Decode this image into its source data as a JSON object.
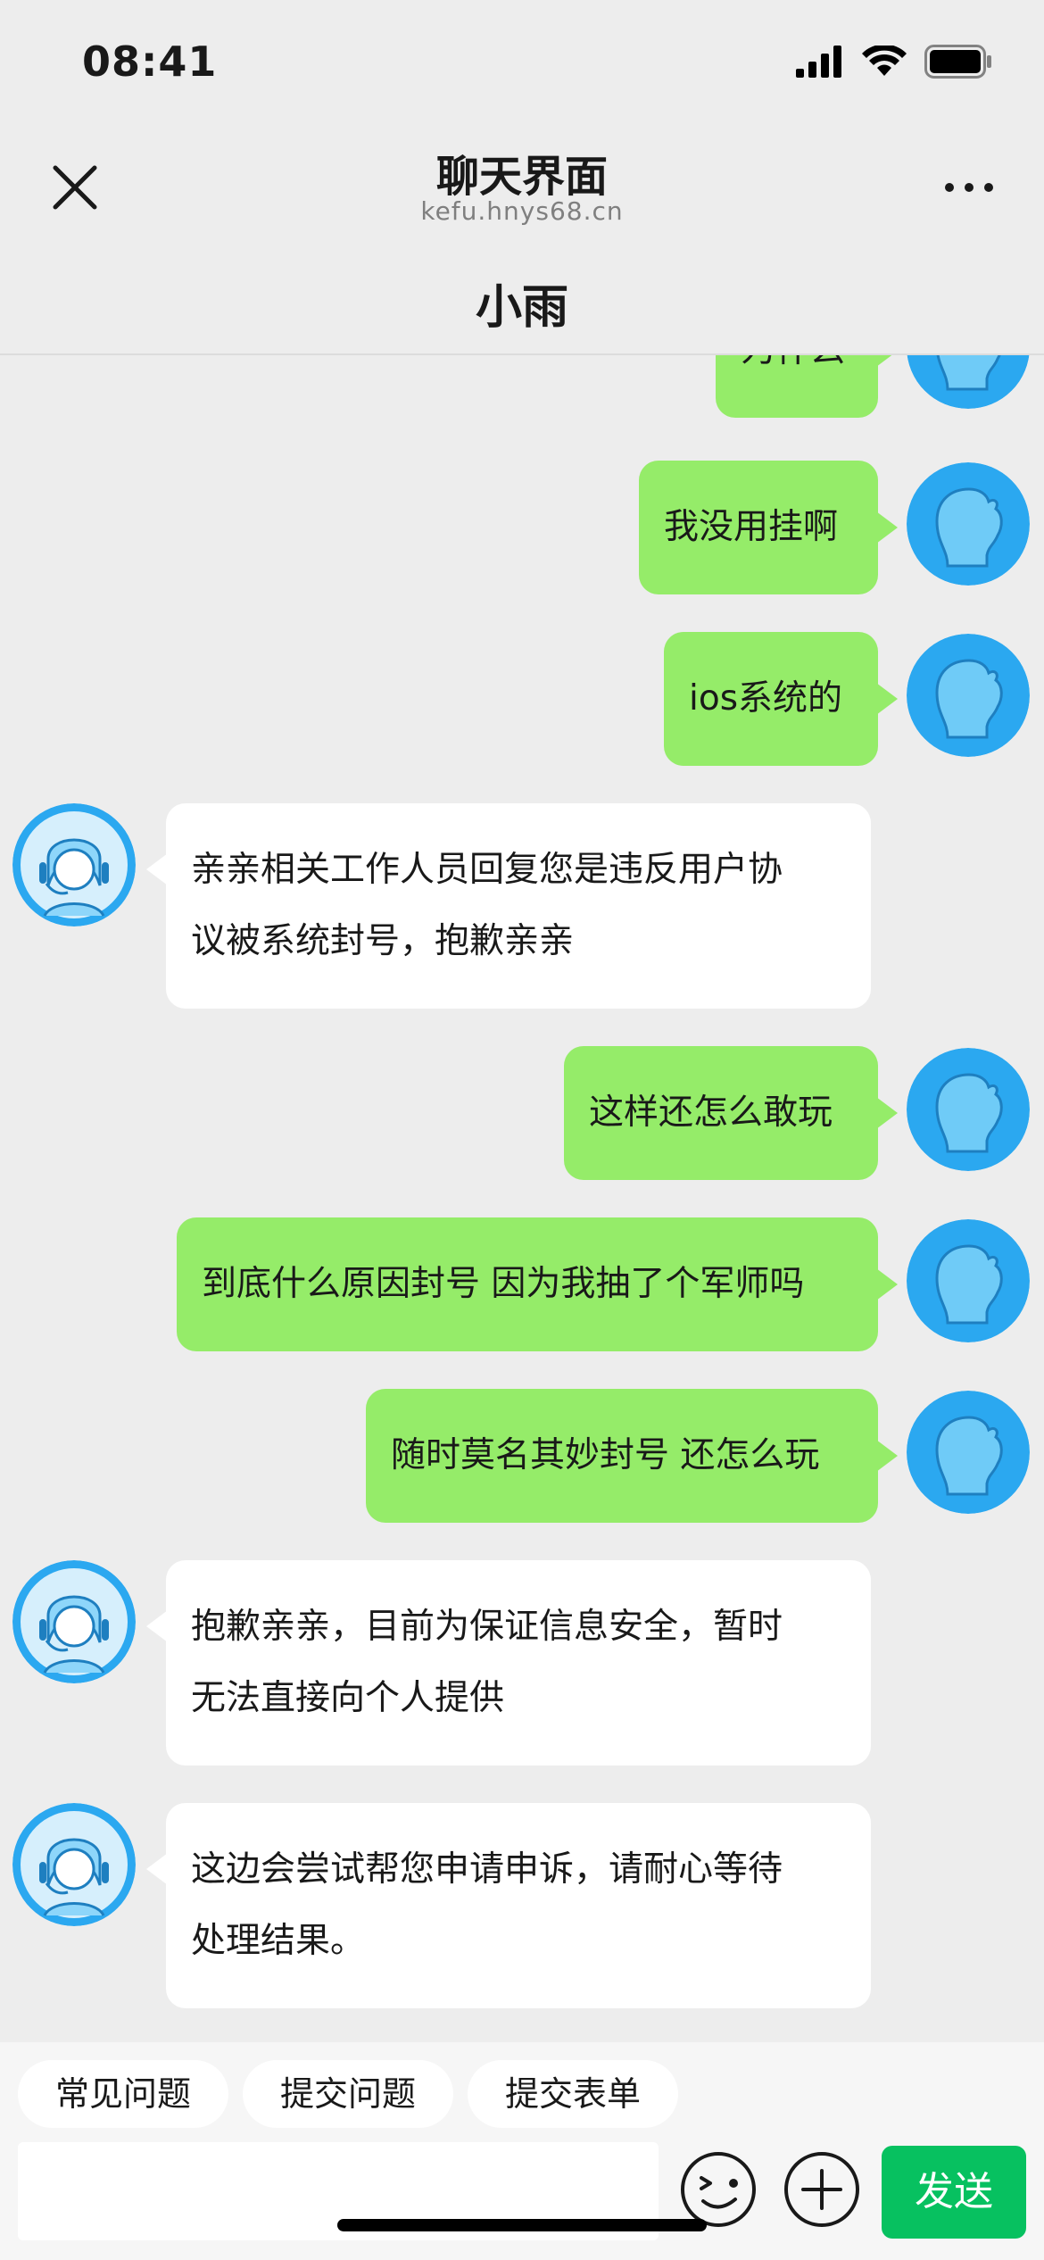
{
  "status_bar": {
    "time": "08:41"
  },
  "nav": {
    "title": "聊天界面",
    "url": "kefu.hnys68.cn"
  },
  "chat": {
    "name": "小雨",
    "messages": [
      {
        "side": "right",
        "text": "为什么"
      },
      {
        "side": "right",
        "text": "我没用挂啊"
      },
      {
        "side": "right",
        "text": "ios系统的"
      },
      {
        "side": "left",
        "lines": [
          "亲亲相关工作人员回复您是违反用户协",
          "议被系统封号，抱歉亲亲"
        ]
      },
      {
        "side": "right",
        "text": "这样还怎么敢玩"
      },
      {
        "side": "right",
        "text": "到底什么原因封号 因为我抽了个军师吗"
      },
      {
        "side": "right",
        "text": "随时莫名其妙封号 还怎么玩"
      },
      {
        "side": "left",
        "lines": [
          "抱歉亲亲，目前为保证信息安全，暂时",
          "无法直接向个人提供"
        ]
      },
      {
        "side": "left",
        "lines": [
          "这边会尝试帮您申请申诉，请耐心等待",
          "处理结果。"
        ]
      }
    ]
  },
  "quick_actions": [
    "常见问题",
    "提交问题",
    "提交表单"
  ],
  "composer": {
    "send_label": "发送",
    "placeholder": ""
  },
  "colors": {
    "user_bubble": "#95EC69",
    "agent_bubble": "#FFFFFF",
    "send_button": "#07C160",
    "avatar_blue": "#2BA8F0"
  }
}
